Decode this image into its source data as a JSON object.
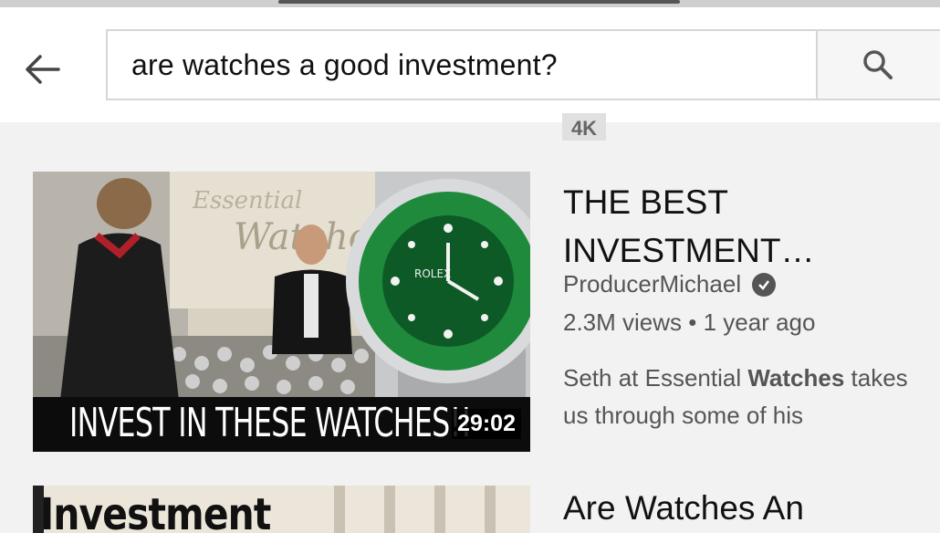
{
  "search": {
    "query": "are watches a good investment?"
  },
  "badge": "4K",
  "results": [
    {
      "title": "THE BEST INVESTMENT…",
      "channel": "ProducerMichael",
      "meta": "2.3M views • 1 year ago",
      "description_pre": "Seth at Essential ",
      "description_bold": "Watches",
      "description_post": " takes us through some of his",
      "thumbnail_caption": "INVEST IN THESE WATCHES!!",
      "duration": "29:02"
    },
    {
      "title": "Are Watches An",
      "thumbnail_caption": "Investment"
    }
  ],
  "icons": {
    "back": "arrow-left-icon",
    "search": "search-icon",
    "verified": "verified-check-icon"
  },
  "colors": {
    "background": "#f2f2f2",
    "watch_bezel": "#1f8a3c"
  }
}
